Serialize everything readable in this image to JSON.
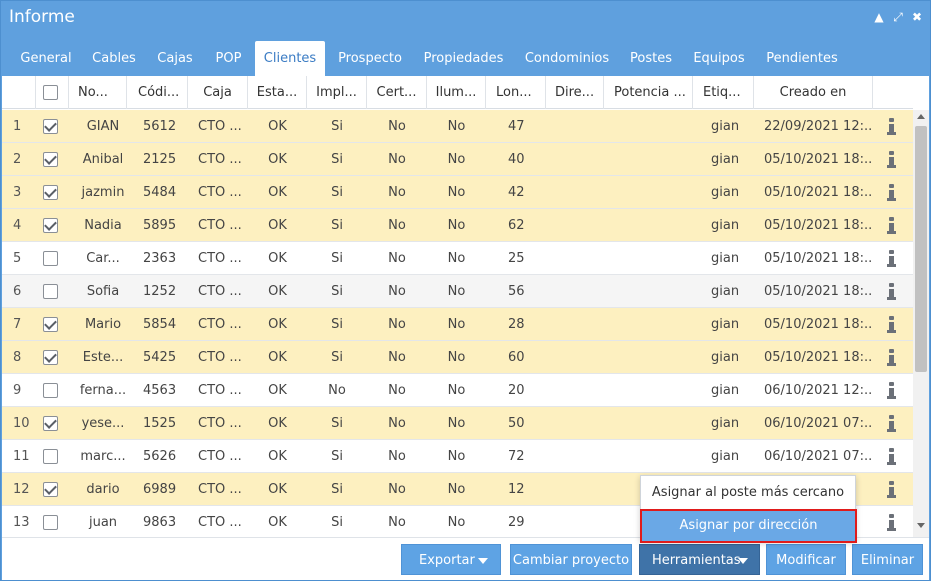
{
  "window": {
    "title": "Informe"
  },
  "controls": {
    "collapse": "▲",
    "expand": "⤢",
    "close": "✖"
  },
  "tabs": [
    {
      "label": "General",
      "active": false
    },
    {
      "label": "Cables",
      "active": false
    },
    {
      "label": "Cajas",
      "active": false
    },
    {
      "label": "POP",
      "active": false
    },
    {
      "label": "Clientes",
      "active": true
    },
    {
      "label": "Prospecto",
      "active": false
    },
    {
      "label": "Propiedades",
      "active": false
    },
    {
      "label": "Condominios",
      "active": false
    },
    {
      "label": "Postes",
      "active": false
    },
    {
      "label": "Equipos",
      "active": false
    },
    {
      "label": "Pendientes",
      "active": false
    }
  ],
  "columns": [
    "No...",
    "Códi...",
    "Caja",
    "Esta...",
    "Impl...",
    "Cert...",
    "Ilum...",
    "Lon...",
    "Dire...",
    "Potencia ...",
    "Etiq...",
    "Creado en"
  ],
  "rows": [
    {
      "n": "1",
      "checked": true,
      "name": "GIAN",
      "code": "5612",
      "caja": "CTO ...",
      "estado": "OK",
      "impl": "Si",
      "cert": "No",
      "ilum": "No",
      "lon": "47",
      "dir": "",
      "pot": "",
      "etiq": "gian",
      "created": "22/09/2021 12:..."
    },
    {
      "n": "2",
      "checked": true,
      "name": "Anibal",
      "code": "2125",
      "caja": "CTO ...",
      "estado": "OK",
      "impl": "Si",
      "cert": "No",
      "ilum": "No",
      "lon": "40",
      "dir": "",
      "pot": "",
      "etiq": "gian",
      "created": "05/10/2021 18:..."
    },
    {
      "n": "3",
      "checked": true,
      "name": "jazmin",
      "code": "5484",
      "caja": "CTO ...",
      "estado": "OK",
      "impl": "Si",
      "cert": "No",
      "ilum": "No",
      "lon": "42",
      "dir": "",
      "pot": "",
      "etiq": "gian",
      "created": "05/10/2021 18:..."
    },
    {
      "n": "4",
      "checked": true,
      "name": "Nadia",
      "code": "5895",
      "caja": "CTO ...",
      "estado": "OK",
      "impl": "Si",
      "cert": "No",
      "ilum": "No",
      "lon": "62",
      "dir": "",
      "pot": "",
      "etiq": "gian",
      "created": "05/10/2021 18:..."
    },
    {
      "n": "5",
      "checked": false,
      "name": "Car...",
      "code": "2363",
      "caja": "CTO ...",
      "estado": "OK",
      "impl": "Si",
      "cert": "No",
      "ilum": "No",
      "lon": "25",
      "dir": "",
      "pot": "",
      "etiq": "gian",
      "created": "05/10/2021 18:..."
    },
    {
      "n": "6",
      "checked": false,
      "name": "Sofia",
      "code": "1252",
      "caja": "CTO ...",
      "estado": "OK",
      "impl": "Si",
      "cert": "No",
      "ilum": "No",
      "lon": "56",
      "dir": "",
      "pot": "",
      "etiq": "gian",
      "created": "05/10/2021 18:..."
    },
    {
      "n": "7",
      "checked": true,
      "name": "Mario",
      "code": "5854",
      "caja": "CTO ...",
      "estado": "OK",
      "impl": "Si",
      "cert": "No",
      "ilum": "No",
      "lon": "28",
      "dir": "",
      "pot": "",
      "etiq": "gian",
      "created": "05/10/2021 18:..."
    },
    {
      "n": "8",
      "checked": true,
      "name": "Este...",
      "code": "5425",
      "caja": "CTO ...",
      "estado": "OK",
      "impl": "Si",
      "cert": "No",
      "ilum": "No",
      "lon": "60",
      "dir": "",
      "pot": "",
      "etiq": "gian",
      "created": "05/10/2021 18:..."
    },
    {
      "n": "9",
      "checked": false,
      "name": "ferna...",
      "code": "4563",
      "caja": "CTO ...",
      "estado": "OK",
      "impl": "No",
      "cert": "No",
      "ilum": "No",
      "lon": "20",
      "dir": "",
      "pot": "",
      "etiq": "gian",
      "created": "06/10/2021 12:..."
    },
    {
      "n": "10",
      "checked": true,
      "name": "yese...",
      "code": "1525",
      "caja": "CTO ...",
      "estado": "OK",
      "impl": "Si",
      "cert": "No",
      "ilum": "No",
      "lon": "50",
      "dir": "",
      "pot": "",
      "etiq": "gian",
      "created": "06/10/2021 07:..."
    },
    {
      "n": "11",
      "checked": false,
      "name": "marc...",
      "code": "5626",
      "caja": "CTO ...",
      "estado": "OK",
      "impl": "Si",
      "cert": "No",
      "ilum": "No",
      "lon": "72",
      "dir": "",
      "pot": "",
      "etiq": "gian",
      "created": "06/10/2021 07:..."
    },
    {
      "n": "12",
      "checked": true,
      "name": "dario",
      "code": "6989",
      "caja": "CTO ...",
      "estado": "OK",
      "impl": "Si",
      "cert": "No",
      "ilum": "No",
      "lon": "12",
      "dir": "",
      "pot": "",
      "etiq": "",
      "created": ""
    },
    {
      "n": "13",
      "checked": false,
      "name": "juan",
      "code": "9863",
      "caja": "CTO ...",
      "estado": "OK",
      "impl": "Si",
      "cert": "No",
      "ilum": "No",
      "lon": "29",
      "dir": "",
      "pot": "",
      "etiq": "",
      "created": ""
    }
  ],
  "footer": {
    "exportar": "Exportar",
    "cambiar": "Cambiar proyecto",
    "herramientas": "Herramientas",
    "modificar": "Modificar",
    "eliminar": "Eliminar"
  },
  "menu": {
    "item1": "Asignar al poste más cercano",
    "item2": "Asignar por dirección"
  },
  "colors": {
    "header_blue": "#5fa0de",
    "selected_row": "#fdf0c0",
    "button_blue": "#5ea3e4",
    "active_button": "#3f73a8",
    "highlight_outline": "#e01b1b"
  }
}
